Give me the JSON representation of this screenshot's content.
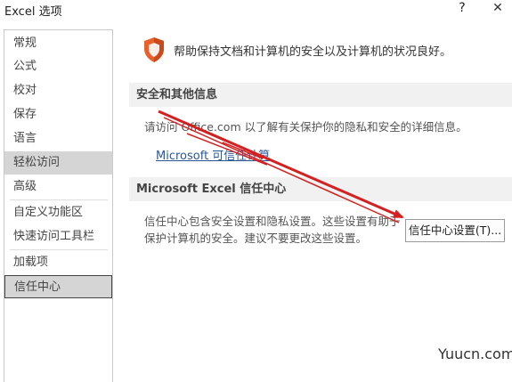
{
  "window": {
    "title": "Excel 选项",
    "help": "?",
    "close": "✕"
  },
  "sidebar": {
    "items": [
      {
        "label": "常规"
      },
      {
        "label": "公式"
      },
      {
        "label": "校对"
      },
      {
        "label": "保存"
      },
      {
        "label": "语言"
      },
      {
        "label": "轻松访问"
      },
      {
        "label": "高级"
      },
      {
        "label": "自定义功能区"
      },
      {
        "label": "快速访问工具栏"
      },
      {
        "label": "加载项"
      },
      {
        "label": "信任中心"
      }
    ]
  },
  "content": {
    "header": "帮助保持文档和计算机的安全以及计算机的状况良好。",
    "privacy": {
      "title": "安全和其他信息",
      "text": "请访问 Office.com 以了解有关保护你的隐私和安全的详细信息。",
      "link": "Microsoft 可信任计算"
    },
    "trust_center": {
      "title": "Microsoft Excel 信任中心",
      "line1": "信任中心包含安全设置和隐私设置。这些设置有助于",
      "line2": "保护计算机的安全。建议不要更改这些设置。",
      "button": "信任中心设置(T)..."
    }
  },
  "watermark": "Yuucn.com",
  "colors": {
    "shield": "#e8612c",
    "annotation_arrow": "#d42020",
    "link": "#2b5797"
  }
}
